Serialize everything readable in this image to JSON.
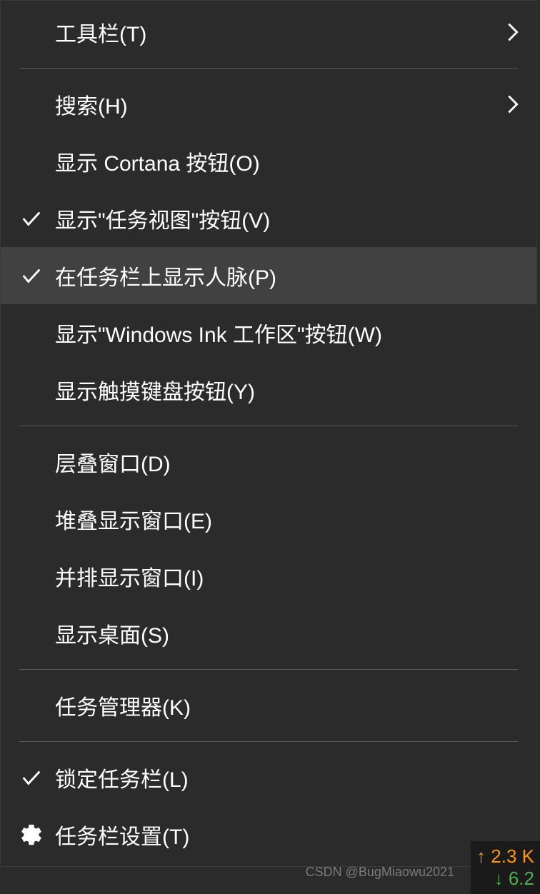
{
  "menu": {
    "items": [
      {
        "label": "工具栏(T)",
        "checked": false,
        "submenu": true,
        "hovered": false,
        "icon": null
      },
      {
        "divider": true
      },
      {
        "label": "搜索(H)",
        "checked": false,
        "submenu": true,
        "hovered": false,
        "icon": null
      },
      {
        "label": "显示 Cortana 按钮(O)",
        "checked": false,
        "submenu": false,
        "hovered": false,
        "icon": null
      },
      {
        "label": "显示\"任务视图\"按钮(V)",
        "checked": true,
        "submenu": false,
        "hovered": false,
        "icon": null
      },
      {
        "label": "在任务栏上显示人脉(P)",
        "checked": true,
        "submenu": false,
        "hovered": true,
        "icon": null
      },
      {
        "label": "显示\"Windows Ink 工作区\"按钮(W)",
        "checked": false,
        "submenu": false,
        "hovered": false,
        "icon": null
      },
      {
        "label": "显示触摸键盘按钮(Y)",
        "checked": false,
        "submenu": false,
        "hovered": false,
        "icon": null
      },
      {
        "divider": true
      },
      {
        "label": "层叠窗口(D)",
        "checked": false,
        "submenu": false,
        "hovered": false,
        "icon": null
      },
      {
        "label": "堆叠显示窗口(E)",
        "checked": false,
        "submenu": false,
        "hovered": false,
        "icon": null
      },
      {
        "label": "并排显示窗口(I)",
        "checked": false,
        "submenu": false,
        "hovered": false,
        "icon": null
      },
      {
        "label": "显示桌面(S)",
        "checked": false,
        "submenu": false,
        "hovered": false,
        "icon": null
      },
      {
        "divider": true
      },
      {
        "label": "任务管理器(K)",
        "checked": false,
        "submenu": false,
        "hovered": false,
        "icon": null
      },
      {
        "divider": true
      },
      {
        "label": "锁定任务栏(L)",
        "checked": true,
        "submenu": false,
        "hovered": false,
        "icon": null
      },
      {
        "label": "任务栏设置(T)",
        "checked": false,
        "submenu": false,
        "hovered": false,
        "icon": "gear"
      }
    ]
  },
  "watermark": "CSDN @BugMiaowu2021",
  "network": {
    "up_icon": "↑",
    "up_value": "2.3 K",
    "down_icon": "↓",
    "down_value": "6.2 "
  }
}
